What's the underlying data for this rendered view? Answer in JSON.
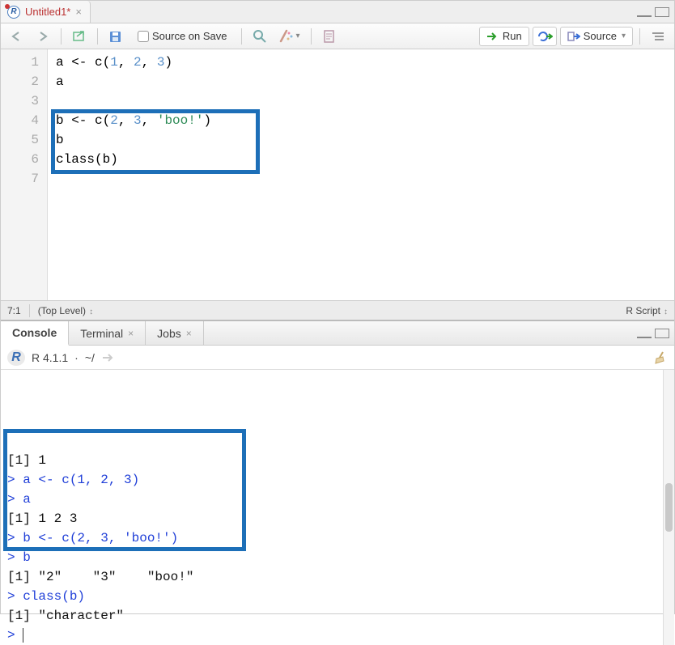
{
  "editor": {
    "tab": {
      "title": "Untitled1*",
      "icon_letter": "R"
    },
    "toolbar": {
      "source_on_save": "Source on Save",
      "run": "Run",
      "source_btn": "Source"
    },
    "code_lines": [
      {
        "n": 1,
        "tokens": [
          "a <- c(",
          {
            "t": "1",
            "c": "num"
          },
          ", ",
          {
            "t": "2",
            "c": "num"
          },
          ", ",
          {
            "t": "3",
            "c": "num"
          },
          ")"
        ]
      },
      {
        "n": 2,
        "tokens": [
          "a"
        ]
      },
      {
        "n": 3,
        "tokens": [
          ""
        ]
      },
      {
        "n": 4,
        "tokens": [
          "b <- c(",
          {
            "t": "2",
            "c": "num"
          },
          ", ",
          {
            "t": "3",
            "c": "num"
          },
          ", ",
          {
            "t": "'boo!'",
            "c": "str"
          },
          ")"
        ]
      },
      {
        "n": 5,
        "tokens": [
          "b"
        ]
      },
      {
        "n": 6,
        "tokens": [
          "class(b)"
        ]
      },
      {
        "n": 7,
        "tokens": [
          ""
        ]
      }
    ],
    "status": {
      "pos": "7:1",
      "scope": "(Top Level)",
      "lang": "R Script"
    }
  },
  "console": {
    "tabs": {
      "console": "Console",
      "terminal": "Terminal",
      "jobs": "Jobs"
    },
    "header": {
      "version": "R 4.1.1",
      "path": "~/"
    },
    "lines": [
      {
        "c": "black",
        "t": "[1] 1"
      },
      {
        "c": "blue",
        "t": "> a <- c(1, 2, 3)"
      },
      {
        "c": "blue",
        "t": "> a"
      },
      {
        "c": "black",
        "t": "[1] 1 2 3"
      },
      {
        "c": "blue",
        "t": "> b <- c(2, 3, 'boo!')"
      },
      {
        "c": "blue",
        "t": "> b"
      },
      {
        "c": "black",
        "t": "[1] \"2\"    \"3\"    \"boo!\""
      },
      {
        "c": "blue",
        "t": "> class(b)"
      },
      {
        "c": "black",
        "t": "[1] \"character\""
      },
      {
        "c": "blue",
        "t": "> ",
        "cursor": true
      }
    ]
  }
}
